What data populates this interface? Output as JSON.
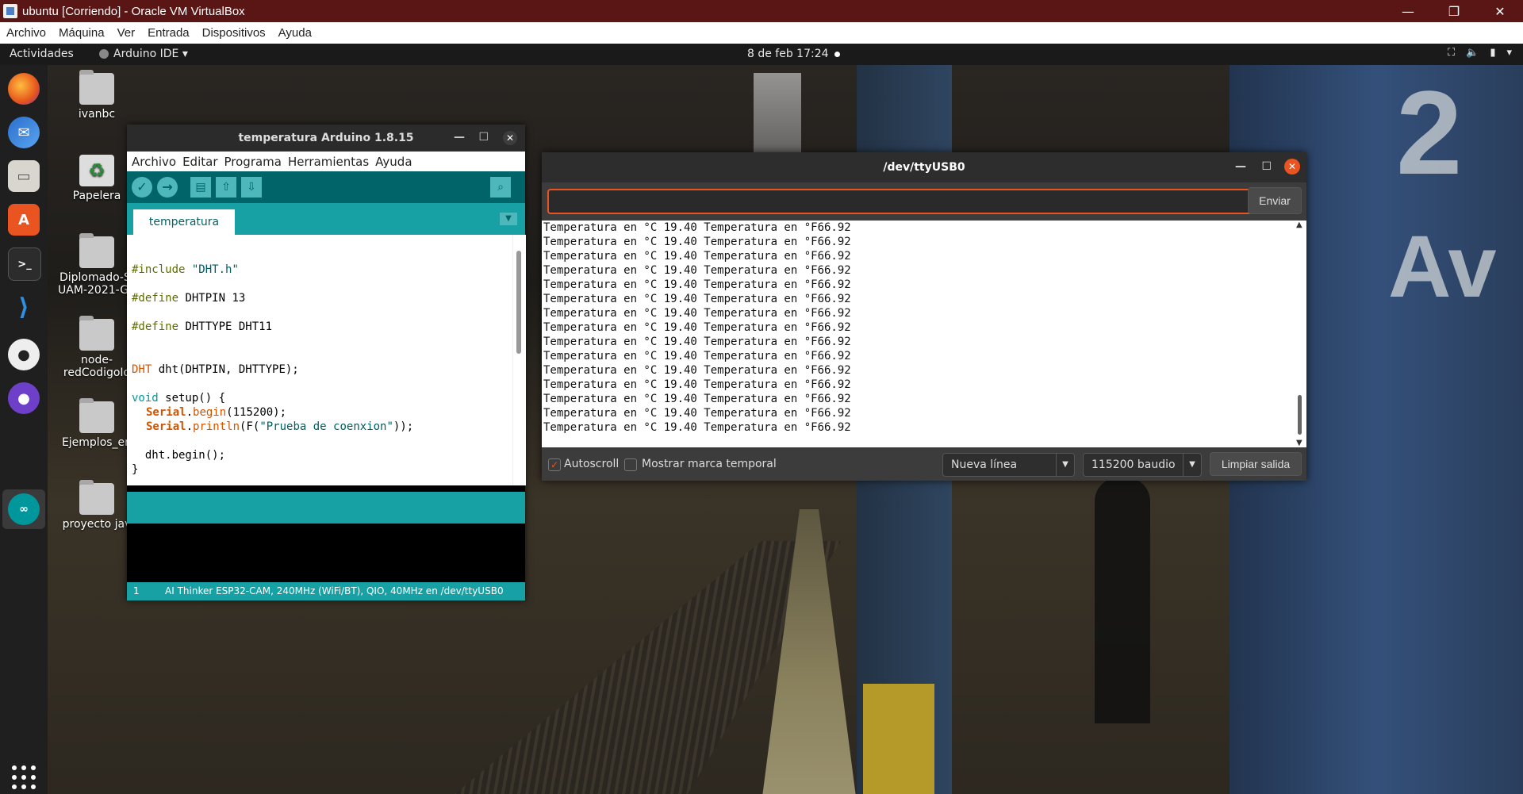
{
  "host": {
    "title": "ubuntu [Corriendo] - Oracle VM VirtualBox",
    "menu": [
      "Archivo",
      "Máquina",
      "Ver",
      "Entrada",
      "Dispositivos",
      "Ayuda"
    ],
    "controls": {
      "minimize": "—",
      "restore": "❐",
      "close": "✕"
    }
  },
  "topbar": {
    "activities": "Actividades",
    "app_menu": "Arduino IDE ▾",
    "clock": "8 de feb  17:24",
    "tray_icons": [
      "network-icon",
      "volume-icon",
      "battery-icon",
      "menu-arrow-icon"
    ]
  },
  "dock": {
    "items": [
      "firefox-icon",
      "thunderbird-icon",
      "files-icon",
      "software-center-icon",
      "terminal-icon",
      "vscode-icon",
      "github-icon",
      "github-desktop-icon",
      "arduino-icon"
    ],
    "active": "arduino-icon"
  },
  "desktop": {
    "icons": [
      {
        "label": "ivanbc"
      },
      {
        "label": "Papelera"
      },
      {
        "label": "Diplomado-SI UAM-2021-G4"
      },
      {
        "label": "node-redCodigoIo"
      },
      {
        "label": "Ejemplos_en"
      },
      {
        "label": "proyecto jav"
      }
    ]
  },
  "arduino": {
    "title": "temperatura Arduino 1.8.15",
    "menu": [
      "Archivo",
      "Editar",
      "Programa",
      "Herramientas",
      "Ayuda"
    ],
    "tab": "temperatura",
    "status_line": "1",
    "board": "AI Thinker ESP32-CAM, 240MHz (WiFi/BT), QIO, 40MHz en /dev/ttyUSB0",
    "code": {
      "l1a": "#include",
      "l1b": " \"DHT.h\"",
      "l2a": "#define",
      "l2b": " DHTPIN 13",
      "l3a": "#define",
      "l3b": " DHTTYPE DHT11",
      "l4a": "DHT",
      "l4b": " dht(DHTPIN, DHTTYPE);",
      "l5a": "void",
      "l5b": " setup() {",
      "l6a": "Serial",
      "l6b": ".",
      "l6c": "begin",
      "l6d": "(115200);",
      "l7a": "Serial",
      "l7b": ".",
      "l7c": "println",
      "l7d": "(F(",
      "l7e": "\"Prueba de coenxion\"",
      "l7f": "));",
      "l8": "  dht.begin();",
      "l9": "}"
    }
  },
  "serial": {
    "title": "/dev/ttyUSB0",
    "input_value": "",
    "send_label": "Enviar",
    "lines": [
      "Temperatura en °C 19.40 Temperatura en °F66.92",
      "Temperatura en °C 19.40 Temperatura en °F66.92",
      "Temperatura en °C 19.40 Temperatura en °F66.92",
      "Temperatura en °C 19.40 Temperatura en °F66.92",
      "Temperatura en °C 19.40 Temperatura en °F66.92",
      "Temperatura en °C 19.40 Temperatura en °F66.92",
      "Temperatura en °C 19.40 Temperatura en °F66.92",
      "Temperatura en °C 19.40 Temperatura en °F66.92",
      "Temperatura en °C 19.40 Temperatura en °F66.92",
      "Temperatura en °C 19.40 Temperatura en °F66.92",
      "Temperatura en °C 19.40 Temperatura en °F66.92",
      "Temperatura en °C 19.40 Temperatura en °F66.92",
      "Temperatura en °C 19.40 Temperatura en °F66.92",
      "Temperatura en °C 19.40 Temperatura en °F66.92",
      "Temperatura en °C 19.40 Temperatura en °F66.92"
    ],
    "autoscroll_label": "Autoscroll",
    "autoscroll_checked": true,
    "timestamp_label": "Mostrar marca temporal",
    "timestamp_checked": false,
    "line_ending": "Nueva línea",
    "baud": "115200 baudio",
    "clear_label": "Limpiar salida"
  },
  "colors": {
    "accent": "#e95420",
    "arduino_teal": "#17a1a5",
    "arduino_dark": "#006468"
  }
}
